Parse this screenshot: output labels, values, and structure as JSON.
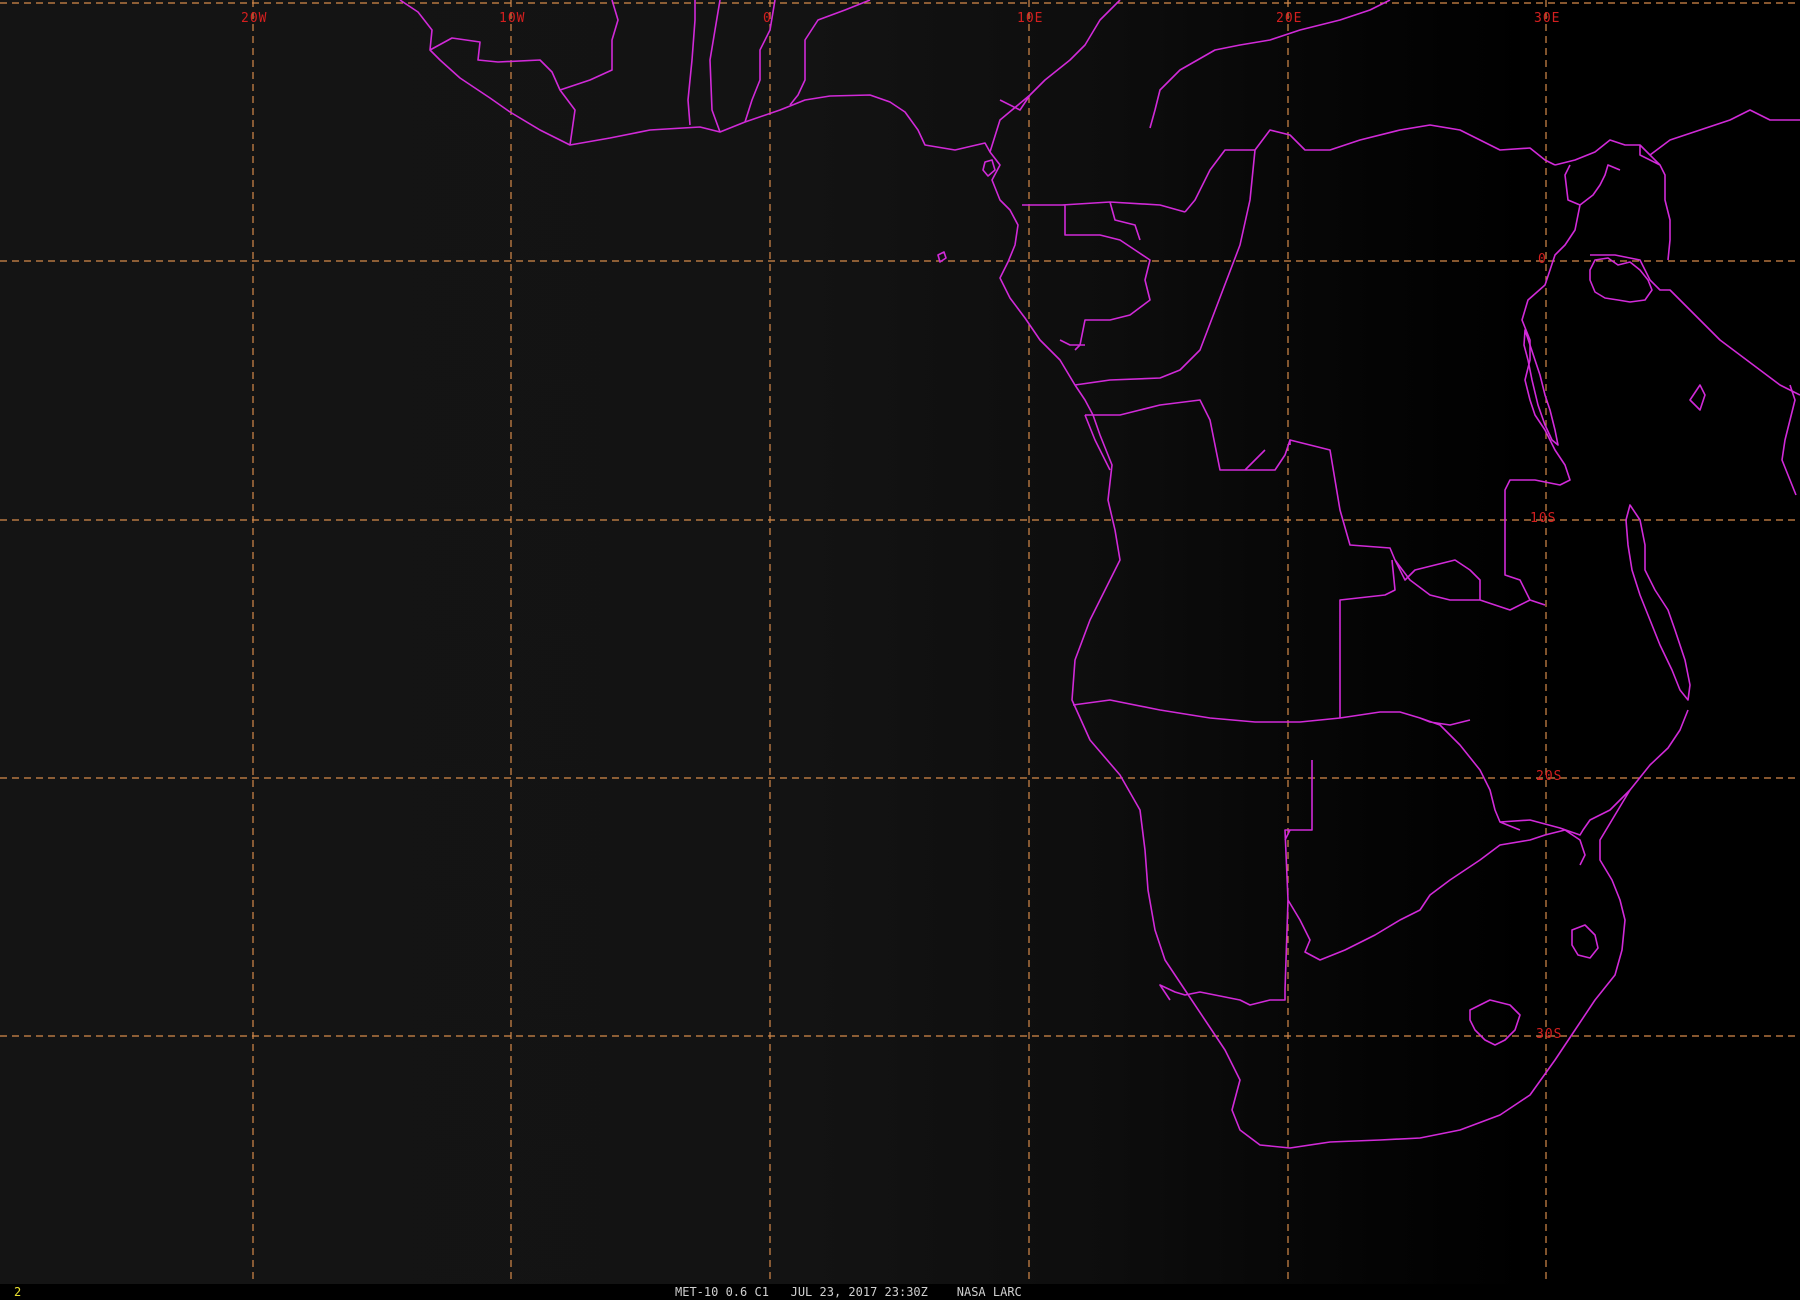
{
  "map": {
    "longitude_labels": [
      "20W",
      "10W",
      "0",
      "10E",
      "20E",
      "30E"
    ],
    "latitude_labels": [
      "0",
      "10S",
      "20S",
      "30S"
    ],
    "colors": {
      "grid": "#d58a4a",
      "borders": "#d12ad8",
      "labels": "#d41f1f"
    }
  },
  "status_bar": {
    "frame_number": "2",
    "caption": "MET-10 0.6 C1   JUL 23, 2017 23:30Z    NASA LARC"
  }
}
